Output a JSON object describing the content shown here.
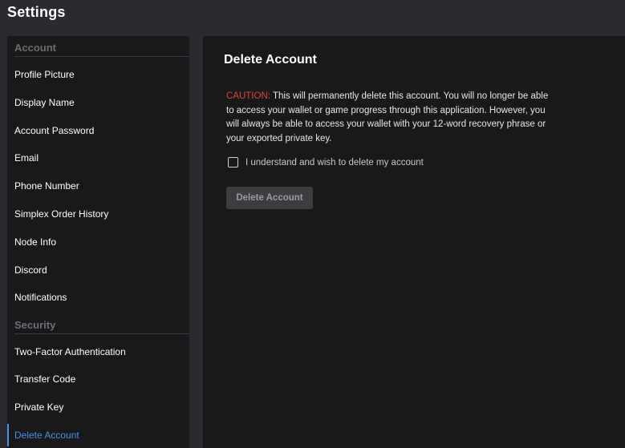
{
  "window": {
    "title": "Settings"
  },
  "sidebar": {
    "sections": [
      {
        "header": "Account",
        "items": [
          {
            "label": "Profile Picture"
          },
          {
            "label": "Display Name"
          },
          {
            "label": "Account Password"
          },
          {
            "label": "Email"
          },
          {
            "label": "Phone Number"
          },
          {
            "label": "Simplex Order History"
          },
          {
            "label": "Node Info"
          },
          {
            "label": "Discord"
          },
          {
            "label": "Notifications"
          }
        ]
      },
      {
        "header": "Security",
        "items": [
          {
            "label": "Two-Factor Authentication"
          },
          {
            "label": "Transfer Code"
          },
          {
            "label": "Private Key"
          },
          {
            "label": "Delete Account",
            "active": true
          }
        ]
      }
    ]
  },
  "main": {
    "title": "Delete Account",
    "caution_label": "CAUTION:",
    "warning_text": " This will permanently delete this account. You will no longer be able to access your wallet or game progress through this application. However, you will always be able to access your wallet with your 12-word recovery phrase or your exported private key.",
    "confirm_checkbox": {
      "label": "I understand and wish to delete my account",
      "checked": false
    },
    "delete_button": {
      "label": "Delete Account",
      "enabled": false
    }
  },
  "colors": {
    "accent": "#4a90e2",
    "caution": "#e0443a",
    "background": "#2b2a30",
    "panel": "#19191b"
  }
}
